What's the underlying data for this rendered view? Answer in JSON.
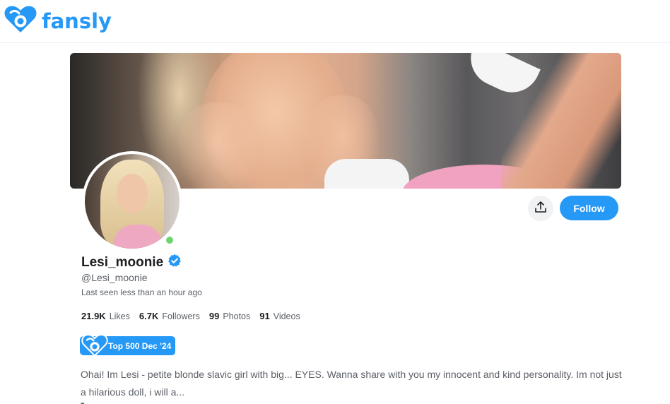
{
  "header": {
    "logo_text": "fansly",
    "logo_icon": "fansly-heart-icon",
    "brand_color": "#2699f7"
  },
  "profile": {
    "display_name": "Lesi_moonie",
    "verified_icon": "verified-badge-icon",
    "username": "@Lesi_moonie",
    "last_seen": "Last seen less than an hour ago",
    "online_status_color": "#6fd46f",
    "stats": [
      {
        "value": "21.9K",
        "label": "Likes"
      },
      {
        "value": "6.7K",
        "label": "Followers"
      },
      {
        "value": "99",
        "label": "Photos"
      },
      {
        "value": "91",
        "label": "Videos"
      }
    ],
    "badge": {
      "label": "Top 500 Dec '24",
      "icon": "fansly-heart-icon"
    },
    "bio": "Ohai! Im Lesi - petite blonde slavic girl with big... EYES. Wanna share with you my innocent and kind personality. Im not just a hilarious doll, i will a..."
  },
  "actions": {
    "share_icon": "share-upload-icon",
    "follow_label": "Follow"
  }
}
